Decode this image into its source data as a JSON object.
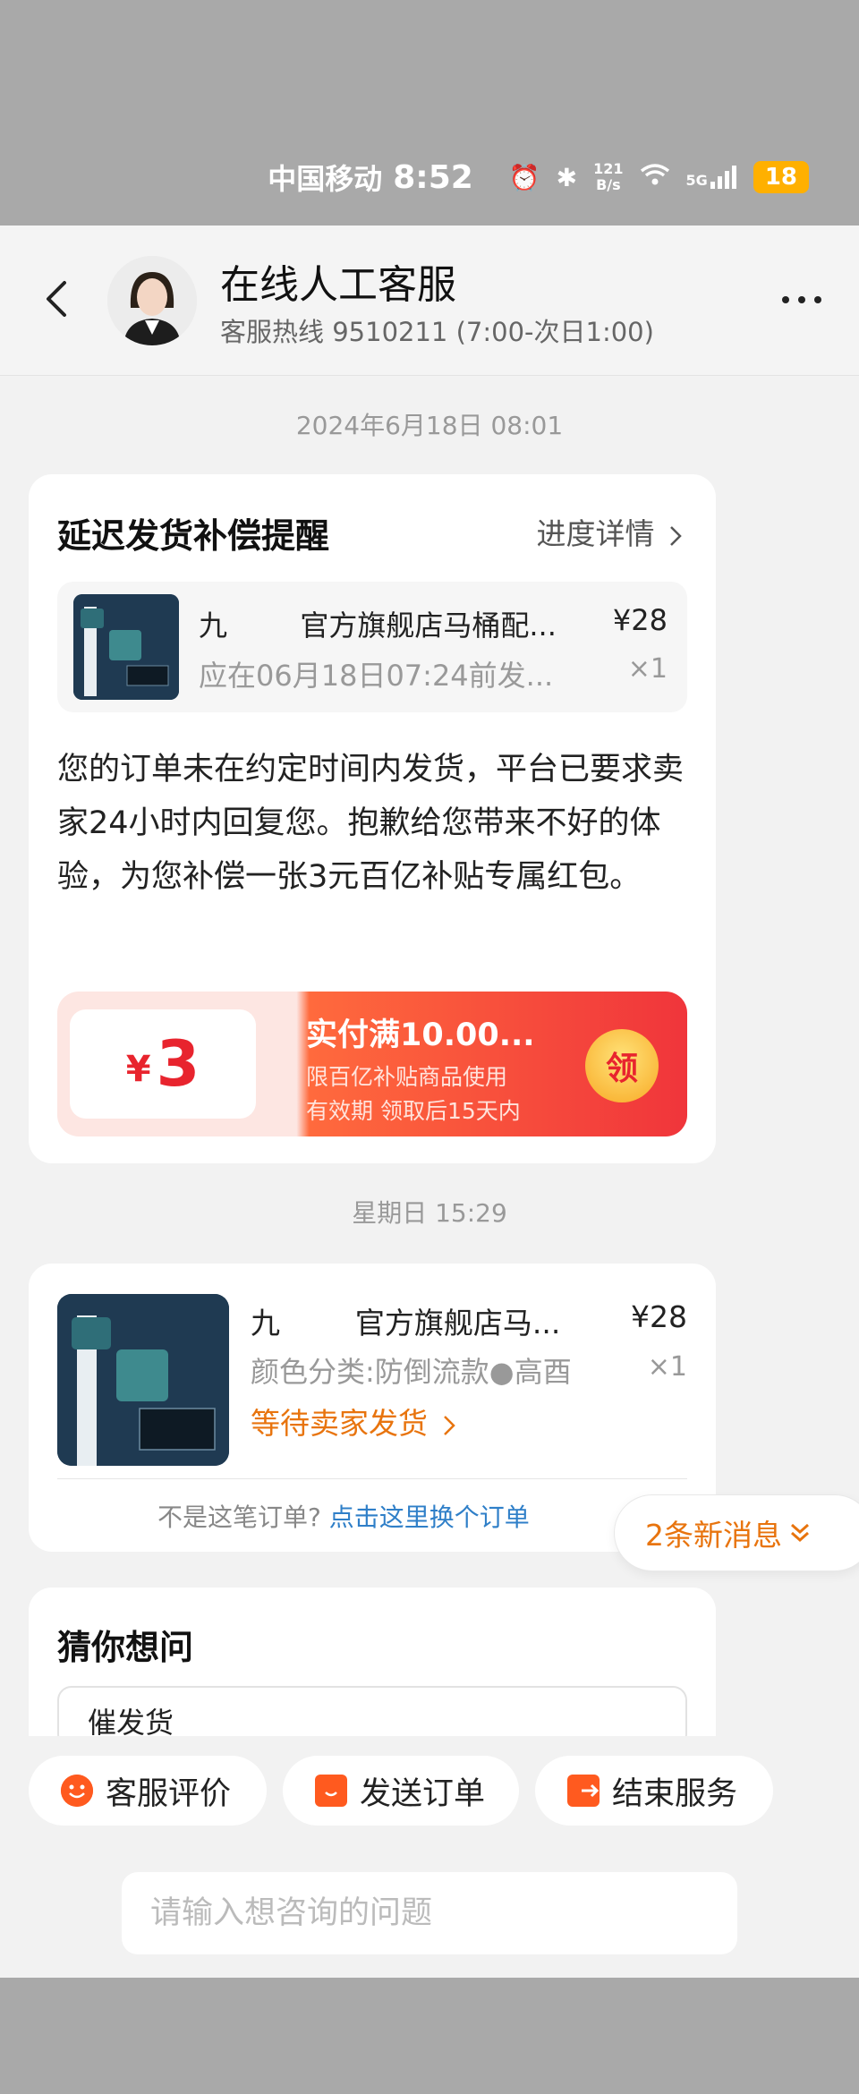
{
  "status_bar": {
    "carrier": "中国移动",
    "time": "8:52",
    "net_speed_top": "121",
    "net_speed_bottom": "B/s",
    "signal": "5G",
    "battery": "18"
  },
  "header": {
    "agent_name": "在线人工客服",
    "hotline": "客服热线 9510211 (7:00-次日1:00)"
  },
  "chat": {
    "timestamp1": "2024年6月18日 08:01",
    "delay_card": {
      "title": "延迟发货补偿提醒",
      "progress_link": "进度详情",
      "product": {
        "name": "九        官方旗舰店马桶配...",
        "price": "¥28",
        "ship_note": "应在06月18日07:24前发...",
        "qty": "×1"
      },
      "body": "您的订单未在约定时间内发货，平台已要求卖家24小时内回复您。抱歉给您带来不好的体验，为您补偿一张3元百亿补贴专属红包。",
      "coupon": {
        "currency": "¥",
        "amount": "3",
        "condition": "实付满10.00...",
        "line1": "限百亿补贴商品使用",
        "line2": "有效期 领取后15天内",
        "claim_label": "领"
      }
    },
    "timestamp2": "星期日 15:29",
    "order_card": {
      "name": "九        官方旗舰店马...",
      "price": "¥28",
      "spec": "颜色分类:防倒流款●高酉",
      "qty": "×1",
      "status": "等待卖家发货",
      "not_this_order": "不是这笔订单?",
      "switch_order": "点击这里换个订单"
    },
    "new_messages": "2条新消息",
    "guess_card": {
      "title": "猜你想问",
      "first_item": "催发货"
    }
  },
  "quick_actions": [
    {
      "label": "客服评价",
      "icon": "smile-icon"
    },
    {
      "label": "发送订单",
      "icon": "bag-icon"
    },
    {
      "label": "结束服务",
      "icon": "exit-icon"
    }
  ],
  "input": {
    "placeholder": "请输入想咨询的问题"
  },
  "colors": {
    "accent_orange": "#e8740e",
    "coupon_red": "#e8242e",
    "link_blue": "#2f7fc8"
  }
}
